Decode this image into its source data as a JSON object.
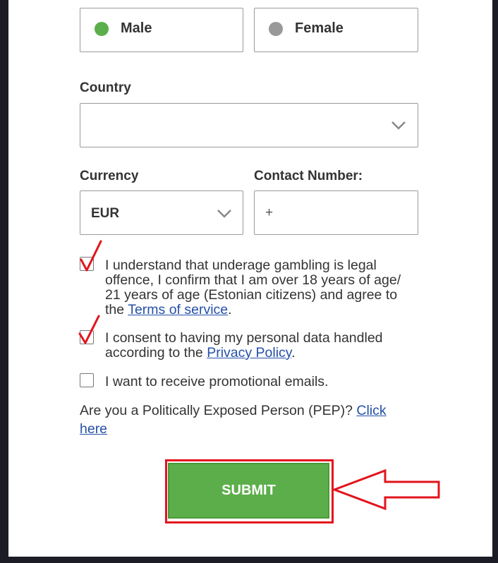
{
  "gender": {
    "options": [
      {
        "label": "Male",
        "selected": true
      },
      {
        "label": "Female",
        "selected": false
      }
    ],
    "selected_color": "#5cae4a",
    "unselected_color": "#999999"
  },
  "country": {
    "label": "Country",
    "value": ""
  },
  "currency": {
    "label": "Currency",
    "value": "EUR"
  },
  "contact": {
    "label": "Contact Number:",
    "prefix": "+"
  },
  "agreements": [
    {
      "text": "I understand that underage gambling is legal offence, I confirm that I am over 18 years of age/ 21 years of age (Estonian citizens) and agree to the ",
      "link": "Terms of service",
      "suffix": ".",
      "checked": true
    },
    {
      "text": "I consent to having my personal data handled according to the ",
      "link": "Privacy Policy",
      "suffix": ".",
      "checked": true
    },
    {
      "text": "I want to receive promotional emails.",
      "checked": false
    }
  ],
  "pep": {
    "question": "Are you a Politically Exposed Person (PEP)? ",
    "link": "Click here"
  },
  "submit": {
    "label": "SUBMIT"
  },
  "colors": {
    "accent_green": "#5cae4a",
    "annotation_red": "#e3141d",
    "link_blue": "#2550a8"
  }
}
